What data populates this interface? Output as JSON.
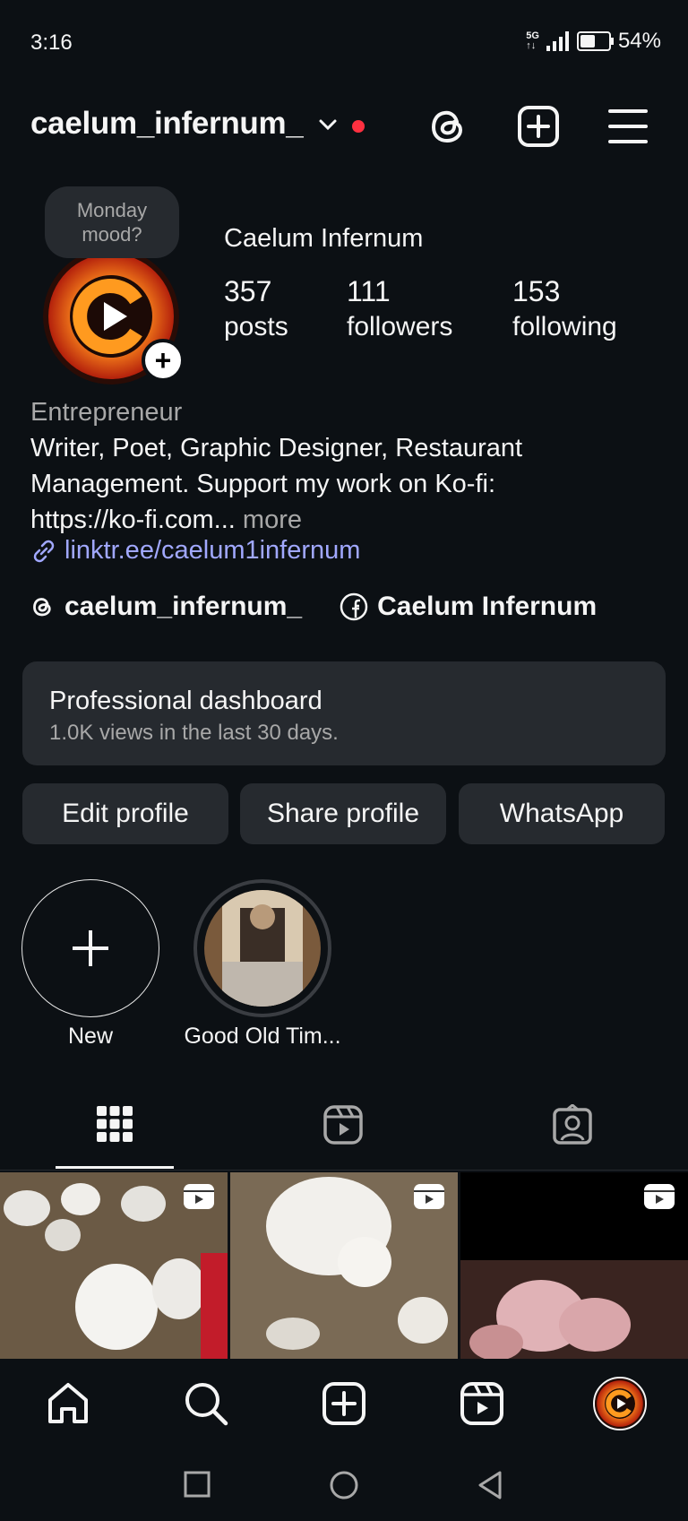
{
  "status": {
    "time": "3:16",
    "network": "5G",
    "battery": "54%",
    "battery_level": 0.54
  },
  "header": {
    "username": "caelum_infernum_"
  },
  "profile": {
    "note": "Monday mood?",
    "full_name": "Caelum Infernum",
    "stats": [
      {
        "value": "357",
        "label": "posts"
      },
      {
        "value": "111",
        "label": "followers"
      },
      {
        "value": "153",
        "label": "following"
      }
    ],
    "category": "Entrepreneur",
    "bio_line1": "Writer, Poet, Graphic Designer, Restaurant",
    "bio_line2": "Management. Support my work on Ko-fi:",
    "bio_line3": "https://ko-fi.com...",
    "bio_more": "more",
    "link": "linktr.ee/caelum1infernum",
    "threads_handle": "caelum_infernum_",
    "facebook_name": "Caelum Infernum"
  },
  "dashboard": {
    "title": "Professional dashboard",
    "subtitle": "1.0K views in the last 30 days."
  },
  "buttons": {
    "edit": "Edit profile",
    "share": "Share profile",
    "whatsapp": "WhatsApp"
  },
  "highlights": [
    {
      "label": "New"
    },
    {
      "label": "Good Old Tim..."
    }
  ],
  "colors": {
    "background": "#0c1014",
    "surface": "#262a2f",
    "link": "#a1a8ff",
    "notification": "#ff3040"
  },
  "icons": [
    "threads-icon",
    "new-post-icon",
    "menu-icon",
    "grid-icon",
    "reels-icon",
    "tagged-icon",
    "home-icon",
    "search-icon",
    "create-icon",
    "reels-nav-icon"
  ]
}
